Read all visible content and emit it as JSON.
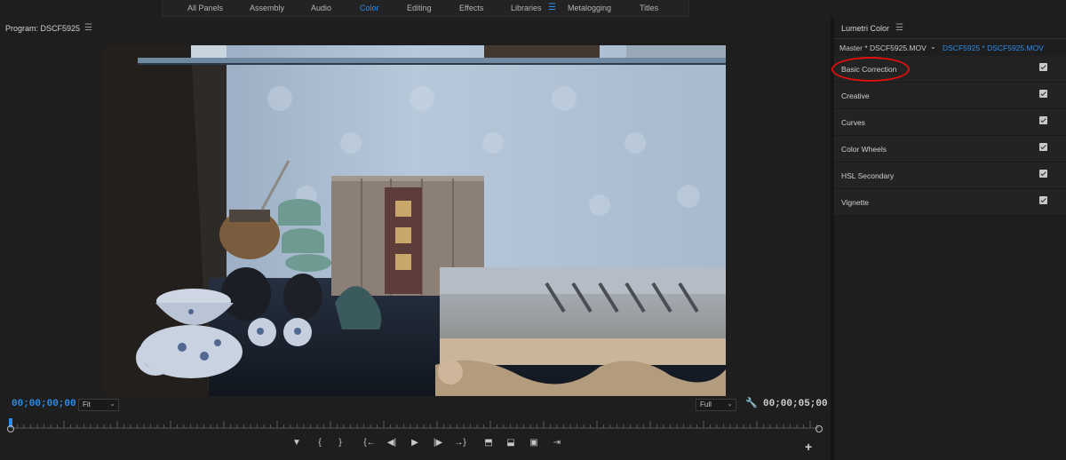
{
  "workspaces": {
    "tabs": [
      "All Panels",
      "Assembly",
      "Audio",
      "Color",
      "Editing",
      "Effects",
      "Libraries",
      "Metalogging",
      "Titles"
    ],
    "active": "Color",
    "menu_icon": "hamburger-icon"
  },
  "program": {
    "title": "Program: DSCF5925",
    "menu_icon": "hamburger-icon",
    "timecode_current": "00;00;00;00",
    "timecode_duration": "00;00;05;00",
    "zoom_label": "Fit",
    "resolution_label": "Full",
    "settings_icon": "wrench-icon",
    "playhead_fraction": 0.0,
    "controls": [
      {
        "name": "add-marker-button",
        "glyph": "▼"
      },
      {
        "name": "mark-in-button",
        "glyph": "{"
      },
      {
        "name": "mark-out-button",
        "glyph": "}"
      },
      {
        "name": "go-to-in-button",
        "glyph": "{←"
      },
      {
        "name": "step-back-button",
        "glyph": "◀|"
      },
      {
        "name": "play-button",
        "glyph": "▶"
      },
      {
        "name": "step-forward-button",
        "glyph": "|▶"
      },
      {
        "name": "go-to-out-button",
        "glyph": "→}"
      },
      {
        "name": "lift-button",
        "glyph": "⬒"
      },
      {
        "name": "extract-button",
        "glyph": "⬓"
      },
      {
        "name": "export-frame-button",
        "glyph": "▣"
      },
      {
        "name": "insert-button",
        "glyph": "⇥"
      }
    ],
    "add_button_glyph": "+"
  },
  "lumetri": {
    "title": "Lumetri Color",
    "menu_icon": "hamburger-icon",
    "master_clip": "Master * DSCF5925.MOV",
    "sequence_clip": "DSCF5925 * DSCF5925.MOV",
    "sections": [
      {
        "label": "Basic Correction",
        "enabled": true
      },
      {
        "label": "Creative",
        "enabled": true
      },
      {
        "label": "Curves",
        "enabled": true
      },
      {
        "label": "Color Wheels",
        "enabled": true
      },
      {
        "label": "HSL Secondary",
        "enabled": true
      },
      {
        "label": "Vignette",
        "enabled": true
      }
    ]
  },
  "colors": {
    "accent": "#2d8ceb",
    "annotation": "#e01010"
  }
}
